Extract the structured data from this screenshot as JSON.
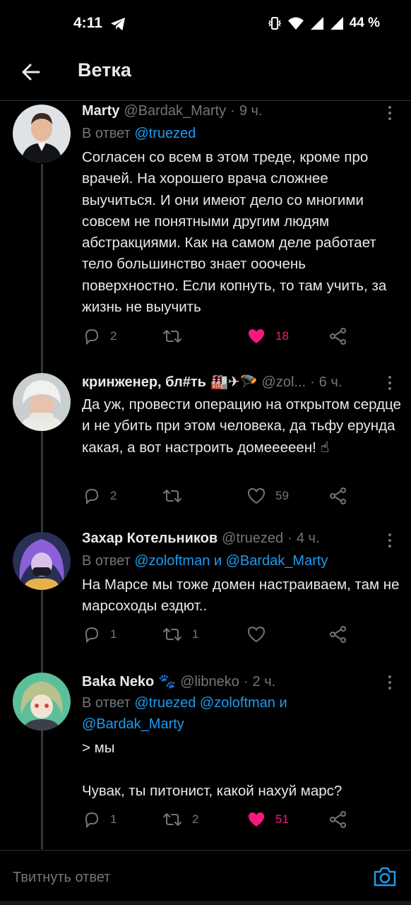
{
  "status": {
    "time": "4:11",
    "battery": "44 %"
  },
  "header": {
    "title": "Ветка"
  },
  "tweets": [
    {
      "name": "Marty",
      "emoji": "",
      "handle": "@Bardak_Marty",
      "time": "9 ч.",
      "reply_prefix": "В ответ",
      "reply_to": "@truezed",
      "reply_to_2": "",
      "text": "Согласен со всем в этом треде, кроме про врачей. На хорошего врача сложнее выучиться. И они имеют дело со многими совсем не понятными другим людям абстракциями. Как на самом деле работает тело большинство знает ооочень поверхностно. Если копнуть, то там учить, за жизнь не выучить",
      "replies": "2",
      "retweets": "",
      "likes": "18",
      "liked": true
    },
    {
      "name": "кринженер, бл#ть",
      "emoji": "🏭✈🪂",
      "handle": "@zol...",
      "time": "6 ч.",
      "text": "Да уж, провести операцию на открытом сердце и не убить при этом человека, да тьфу ерунда какая, а вот настроить домееееен! ☝",
      "replies": "2",
      "retweets": "",
      "likes": "59",
      "liked": false
    },
    {
      "name": "Захар Котельников",
      "emoji": "",
      "handle": "@truezed",
      "time": "4 ч.",
      "reply_prefix": "В ответ",
      "reply_to": "@zoloftman и @Bardak_Marty",
      "text": "На Марсе мы тоже домен настраиваем, там не марсоходы ездют..",
      "replies": "1",
      "retweets": "1",
      "likes": "",
      "liked": false
    },
    {
      "name": "Baka Neko",
      "emoji": "🐾",
      "handle": "@libneko",
      "time": "2 ч.",
      "reply_prefix": "В ответ",
      "reply_to": "@truezed @zoloftman и",
      "reply_to_2": "@Bardak_Marty",
      "text": "> мы\n\nЧувак, ты питонист, какой нахуй марс?",
      "replies": "1",
      "retweets": "2",
      "likes": "51",
      "liked": true
    }
  ],
  "composer": {
    "placeholder": "Твитнуть ответ"
  },
  "colors": {
    "accent": "#1d9bf0",
    "like": "#f91880",
    "muted": "#71767b",
    "background": "#000000"
  }
}
